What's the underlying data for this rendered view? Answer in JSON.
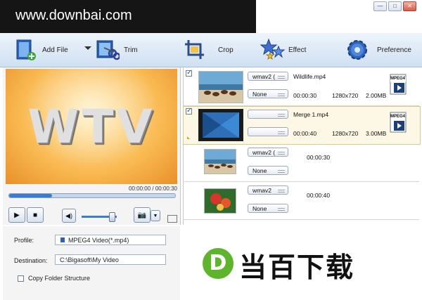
{
  "watermark": {
    "text": "www.downbai.com"
  },
  "window": {
    "controls": [
      "—",
      "□",
      "✕"
    ]
  },
  "toolbar": {
    "add_file": "Add File",
    "trim": "Trim",
    "crop": "Crop",
    "effect": "Effect",
    "preference": "Preference"
  },
  "preview": {
    "overlay_text": "WTV",
    "timecode": "00:00:00 / 00:00:30",
    "seek_progress": 0.26,
    "volume": 0.85
  },
  "form": {
    "profile_label": "Profile:",
    "profile_value": "MPEG4 Video(*.mp4)",
    "destination_label": "Destination:",
    "destination_value": "C:\\Bigasoft\\My Video",
    "copy_folder_label": "Copy Folder Structure",
    "copy_folder_checked": false
  },
  "files": [
    {
      "checked": true,
      "codec": "wmav2 (",
      "subtitle": "None",
      "name": "Wildlife.mp4",
      "duration": "00:00:30",
      "resolution": "1280x720",
      "size": "2.00MB",
      "badge": "MPEG4",
      "selected": false,
      "thumb": "beach-horses"
    },
    {
      "checked": true,
      "codec": "",
      "subtitle": "",
      "name": "Merge 1.mp4",
      "duration": "00:00:40",
      "resolution": "1280x720",
      "size": "3.00MB",
      "badge": "MPEG4",
      "selected": true,
      "thumb": "merge"
    },
    {
      "checked": false,
      "codec": "wmav2 (",
      "subtitle": "None",
      "name": "",
      "duration": "00:00:30",
      "resolution": "",
      "size": "",
      "badge": "",
      "selected": false,
      "thumb": "beach-horses"
    },
    {
      "checked": false,
      "codec": "wmav2",
      "subtitle": "None",
      "name": "",
      "duration": "00:00:40",
      "resolution": "",
      "size": "",
      "badge": "",
      "selected": false,
      "thumb": "flowers"
    }
  ],
  "logo": {
    "letter": "D",
    "text": "当百下载"
  },
  "colors": {
    "toolbar_top": "#eef4fb",
    "toolbar_bottom": "#cfe0f2",
    "accent": "#3a7bd5",
    "logo_green": "#5fb42e"
  }
}
